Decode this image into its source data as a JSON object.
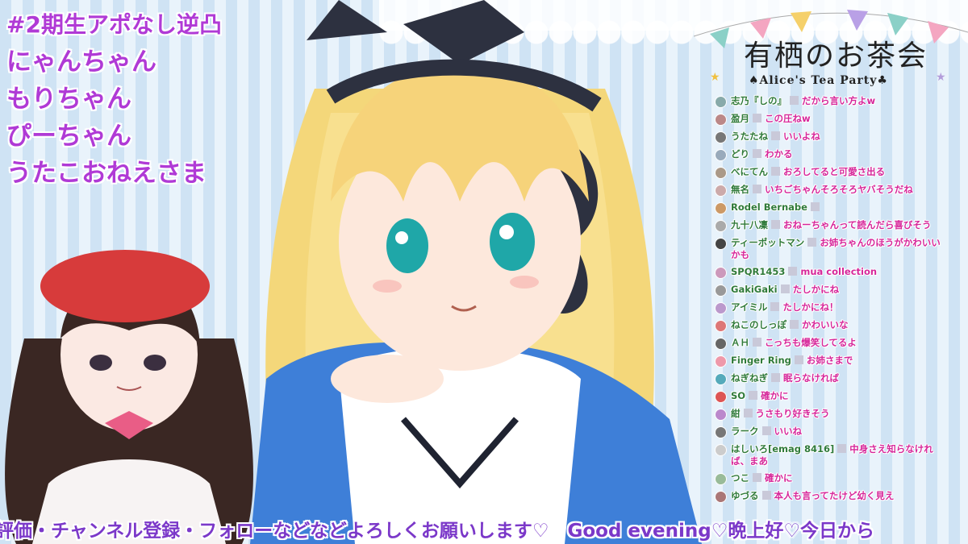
{
  "topics": {
    "items": [
      "#2期生アポなし逆凸",
      "にゃんちゃん",
      "もりちゃん",
      "ぴーちゃん",
      "うたこおねえさま"
    ]
  },
  "logo": {
    "title": "有栖のお茶会",
    "subtitle": "♠Alice's Tea Party♣"
  },
  "chat": {
    "messages": [
      {
        "name": "志乃『しの』",
        "text": "だから言い方よw"
      },
      {
        "name": "盈月",
        "text": "この圧ねw"
      },
      {
        "name": "うたたね",
        "text": "いいよね"
      },
      {
        "name": "どり",
        "text": "わかる"
      },
      {
        "name": "べにてん",
        "text": "おろしてると可愛さ出る"
      },
      {
        "name": "無名",
        "text": "いちごちゃんそろそろヤバそうだね"
      },
      {
        "name": "Rodel Bernabe",
        "text": ""
      },
      {
        "name": "九十八凜",
        "text": "おねーちゃんって読んだら喜びそう"
      },
      {
        "name": "ティーポットマン",
        "text": "お姉ちゃんのほうがかわいいかも"
      },
      {
        "name": "SPQR1453",
        "text": "mua collection"
      },
      {
        "name": "GakiGaki",
        "text": "たしかにね"
      },
      {
        "name": "アイミル",
        "text": "たしかにね！"
      },
      {
        "name": "ねこのしっぽ",
        "text": "かわいいな"
      },
      {
        "name": "ＡＨ",
        "text": "こっちも爆笑してるよ"
      },
      {
        "name": "Finger Ring",
        "text": "お姉さまで"
      },
      {
        "name": "ねぎねぎ",
        "text": "眠らなければ"
      },
      {
        "name": "SO",
        "text": "確かに"
      },
      {
        "name": "紺",
        "text": "うさもり好きそう"
      },
      {
        "name": "ラーク",
        "text": "いいね"
      },
      {
        "name": "はしいろ[emag 8416]",
        "text": "中身さえ知らなければ、まあ"
      },
      {
        "name": "つこ",
        "text": "確かに"
      },
      {
        "name": "ゆづる",
        "text": "本人も言ってたけど幼く見え"
      }
    ]
  },
  "ticker": {
    "text": "評価・チャンネル登録・フォローなどなどよろしくお願いします♡　Good evening♡晩上好♡今日から"
  },
  "colors": {
    "topic": "#b03ad6",
    "chat_name": "#2f7a3a",
    "chat_text": "#d6279a",
    "ticker": "#7b38c9",
    "stripe_light": "#e9f3fb",
    "stripe_dark": "#cfe3f4"
  }
}
